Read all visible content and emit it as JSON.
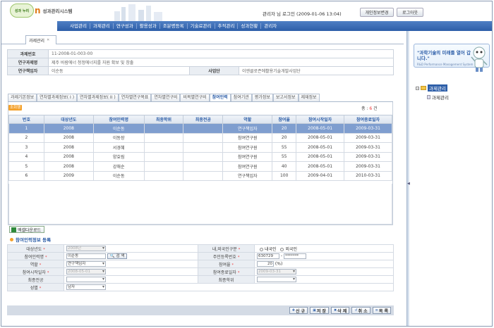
{
  "header": {
    "logo_badge": "성과 누리",
    "logo_n": "n",
    "logo_text": "성과관리시스템",
    "login_info": "관리자 님 로그인 (2009-01-06 13:04)",
    "btn_profile": "개인정보변경",
    "btn_logout": "로그아웃"
  },
  "nav": [
    "사업관리",
    "과제관리",
    "연구성과",
    "활용성과",
    "조분명등록",
    "기술료관리",
    "추적관리",
    "성과현황",
    "관리자"
  ],
  "window_tab": {
    "label": "과제관리",
    "close": "✕"
  },
  "info": {
    "row1_label": "과제번호",
    "row1_value": "11-2008-01-003-00",
    "row2_label": "연구과제명",
    "row2_value": "제주 바람에너 청정에너지를 자원 확보 및 창출",
    "row3_label": "연구책임자",
    "row3_value": "이순동",
    "row3_label2": "사업단",
    "row3_value2": "이엔클로즌에활용기술개발사업단"
  },
  "subtabs": [
    "과제기본정보",
    "연차별과제정보( I )",
    "연차별과제정보( II )",
    "연차별연구목표",
    "연차별연구비",
    "비목별연구비",
    "참여인력",
    "참여기관",
    "평가정보",
    "보고서정보",
    "제재정보"
  ],
  "subtab_active": 6,
  "panel": {
    "badge": "조회행",
    "total_label": "총 :",
    "total_value": "6",
    "total_unit": "건"
  },
  "grid": {
    "columns": [
      "번호",
      "대상년도",
      "참여인력명",
      "최종학위",
      "최종전공",
      "역할",
      "참여율",
      "참여시작일자",
      "참여종료일자"
    ],
    "rows": [
      [
        "1",
        "2008",
        "이순동",
        "",
        "",
        "연구책임자",
        "20",
        "2008-05-01",
        "2009-03-31"
      ],
      [
        "2",
        "2008",
        "이동장",
        "",
        "",
        "참여연구원",
        "20",
        "2008-05-01",
        "2009-03-31"
      ],
      [
        "3",
        "2008",
        "서경혜",
        "",
        "",
        "참여연구원",
        "55",
        "2008-05-01",
        "2009-03-31"
      ],
      [
        "4",
        "2008",
        "양효림",
        "",
        "",
        "참여연구원",
        "55",
        "2008-05-01",
        "2009-03-31"
      ],
      [
        "5",
        "2008",
        "강해순",
        "",
        "",
        "참여연구원",
        "40",
        "2008-05-01",
        "2009-03-31"
      ],
      [
        "6",
        "2009",
        "이순동",
        "",
        "",
        "연구책임자",
        "100",
        "2009-04-01",
        "2010-03-31"
      ]
    ]
  },
  "excel_btn": "엑셀다운로드",
  "section_title": "참여인력정보 등록",
  "form": {
    "year_label": "대상년도",
    "year_value": "2008년",
    "name_label": "참여인력명",
    "name_value": "이순동",
    "search_btn": "검 색",
    "role_label": "역할",
    "role_value": "연구책임자",
    "start_label": "참여시작일자",
    "start_value": "2008-05-01",
    "major_label": "최종전공",
    "gender_label": "성별",
    "gender_value": "남자",
    "nationality_label": "내,외국인구분",
    "domestic": "내국인",
    "foreign": "외국인",
    "ssn_label": "주민등록번호",
    "ssn1": "630729",
    "ssn_dash": "-",
    "ssn2": "*******",
    "rate_label": "참여율",
    "rate_value": "20",
    "rate_unit": "(%)",
    "end_label": "참여종료일자",
    "end_value": "2009-03-31",
    "degree_label": "최종학위"
  },
  "actions": [
    "신 규",
    "저 장",
    "삭 제",
    "취 소",
    "목 록"
  ],
  "right": {
    "banner_title": "\"과학기술의 미래를 열어 갑니다.\"",
    "banner_sub": "R&D Performance Management System",
    "tree_root": "과제관리",
    "tree_child": "과제관리"
  }
}
